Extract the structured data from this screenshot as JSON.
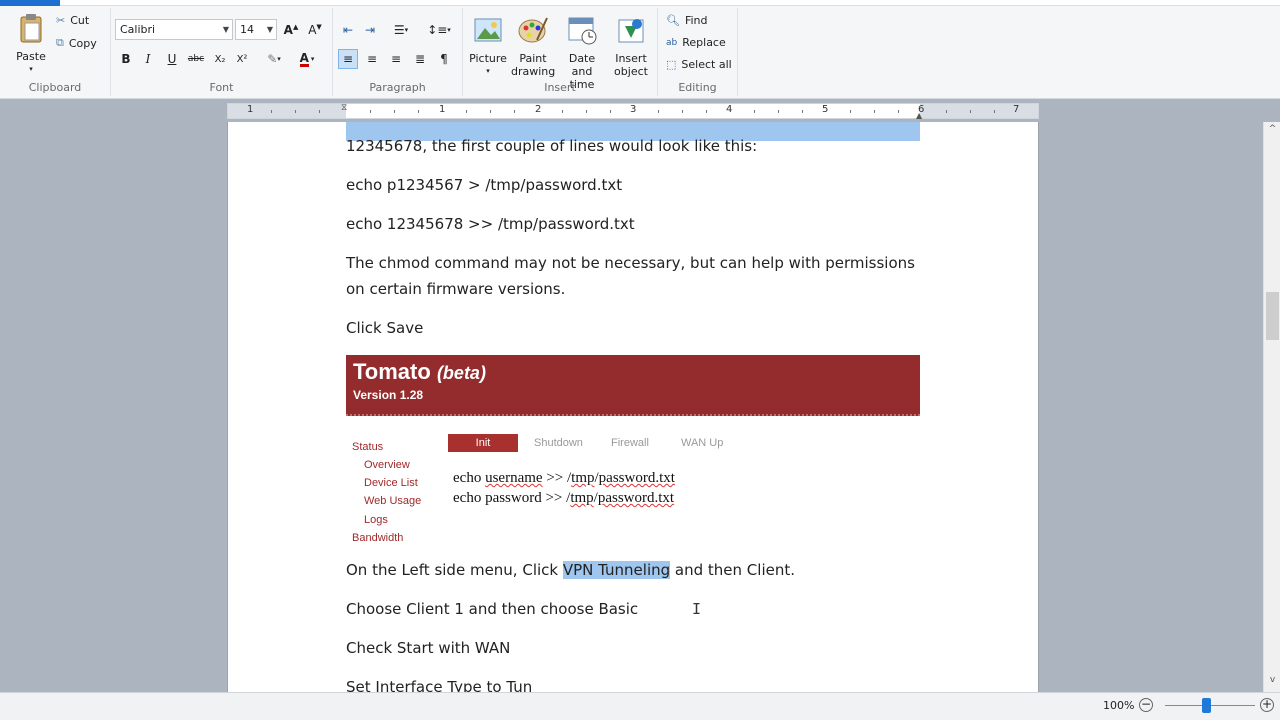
{
  "ribbon": {
    "clipboard": {
      "label": "Clipboard",
      "paste": "Paste",
      "cut": "Cut",
      "copy": "Copy"
    },
    "font": {
      "label": "Font",
      "family": "Calibri",
      "size": "14",
      "bold": "B",
      "italic": "I",
      "underline": "U",
      "strike": "abc",
      "sub": "X₂",
      "sup": "X²",
      "color_a": "A"
    },
    "paragraph": {
      "label": "Paragraph"
    },
    "insert": {
      "label": "Insert",
      "picture": "Picture",
      "paint1": "Paint",
      "paint2": "drawing",
      "date1": "Date and",
      "date2": "time",
      "obj1": "Insert",
      "obj2": "object"
    },
    "editing": {
      "label": "Editing",
      "find": "Find",
      "replace": "Replace",
      "select_all": "Select all"
    }
  },
  "ruler": {
    "numbers": [
      "1",
      "1",
      "2",
      "3",
      "4",
      "5",
      "6",
      "7"
    ]
  },
  "document": {
    "line_top": "12345678, the first couple of lines would look like this:",
    "p1": "echo p1234567 > /tmp/password.txt",
    "p2": "echo 12345678 >> /tmp/password.txt",
    "p3": "The chmod command may not be necessary, but can help with permissions on certain firmware versions.",
    "p4": "Click Save",
    "p5_pre": "On the Left side menu, Click ",
    "p5_hl": "VPN Tunneling",
    "p5_post": " and then Client.",
    "p6": "Choose Client 1 and then choose Basic",
    "p7": "Check Start with WAN",
    "p8": "Set Interface Type to Tun"
  },
  "embedded": {
    "brand": "Tomato",
    "beta": "(beta)",
    "version": "Version 1.28",
    "nav": [
      "Status",
      "Overview",
      "Device List",
      "Web Usage",
      "Logs",
      "Bandwidth"
    ],
    "tabs": [
      "Init",
      "Shutdown",
      "Firewall",
      "WAN Up"
    ],
    "code1_a": "echo ",
    "code1_b": "username",
    "code1_c": " >> /",
    "code1_d": "tmp",
    "code1_e": "/",
    "code1_f": "password.txt",
    "code2_a": "echo password >> /",
    "code2_b": "tmp",
    "code2_c": "/",
    "code2_d": "password.txt"
  },
  "status": {
    "zoom": "100%",
    "minus": "−",
    "plus": "+"
  },
  "colors": {
    "selection": "#9ec6ee",
    "tomato_red": "#942b2d",
    "accent": "#1e6fd0"
  }
}
